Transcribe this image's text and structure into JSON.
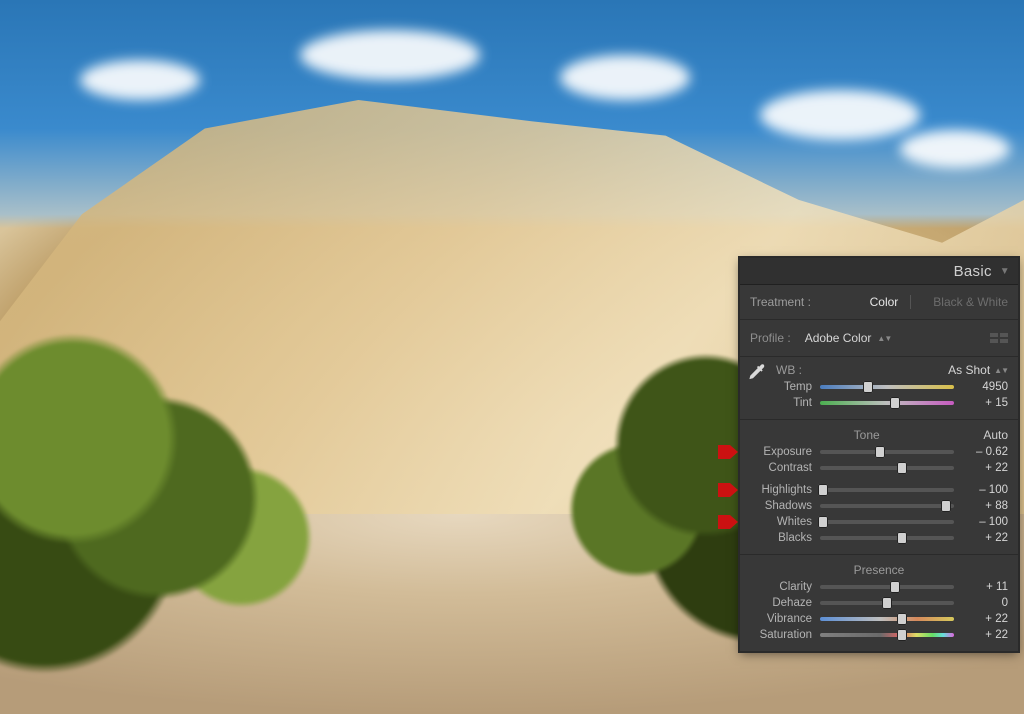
{
  "panel": {
    "title": "Basic",
    "treatment": {
      "label": "Treatment :",
      "color": "Color",
      "bw": "Black & White"
    },
    "profile": {
      "label": "Profile :",
      "value": "Adobe Color"
    },
    "wb": {
      "section": "WB :",
      "preset": "As Shot",
      "temp": {
        "label": "Temp",
        "value": "4950",
        "pos": 36
      },
      "tint": {
        "label": "Tint",
        "value": "+ 15",
        "pos": 56
      }
    },
    "tone": {
      "title": "Tone",
      "auto": "Auto",
      "exposure": {
        "label": "Exposure",
        "value": "– 0.62",
        "pos": 45,
        "marked": true
      },
      "contrast": {
        "label": "Contrast",
        "value": "+ 22",
        "pos": 61,
        "marked": false
      },
      "highlights": {
        "label": "Highlights",
        "value": "– 100",
        "pos": 2,
        "marked": true
      },
      "shadows": {
        "label": "Shadows",
        "value": "+ 88",
        "pos": 94,
        "marked": false
      },
      "whites": {
        "label": "Whites",
        "value": "– 100",
        "pos": 2,
        "marked": true
      },
      "blacks": {
        "label": "Blacks",
        "value": "+ 22",
        "pos": 61,
        "marked": false
      }
    },
    "presence": {
      "title": "Presence",
      "clarity": {
        "label": "Clarity",
        "value": "+ 11",
        "pos": 56
      },
      "dehaze": {
        "label": "Dehaze",
        "value": "0",
        "pos": 50
      },
      "vibrance": {
        "label": "Vibrance",
        "value": "+ 22",
        "pos": 61
      },
      "saturation": {
        "label": "Saturation",
        "value": "+ 22",
        "pos": 61
      }
    }
  }
}
